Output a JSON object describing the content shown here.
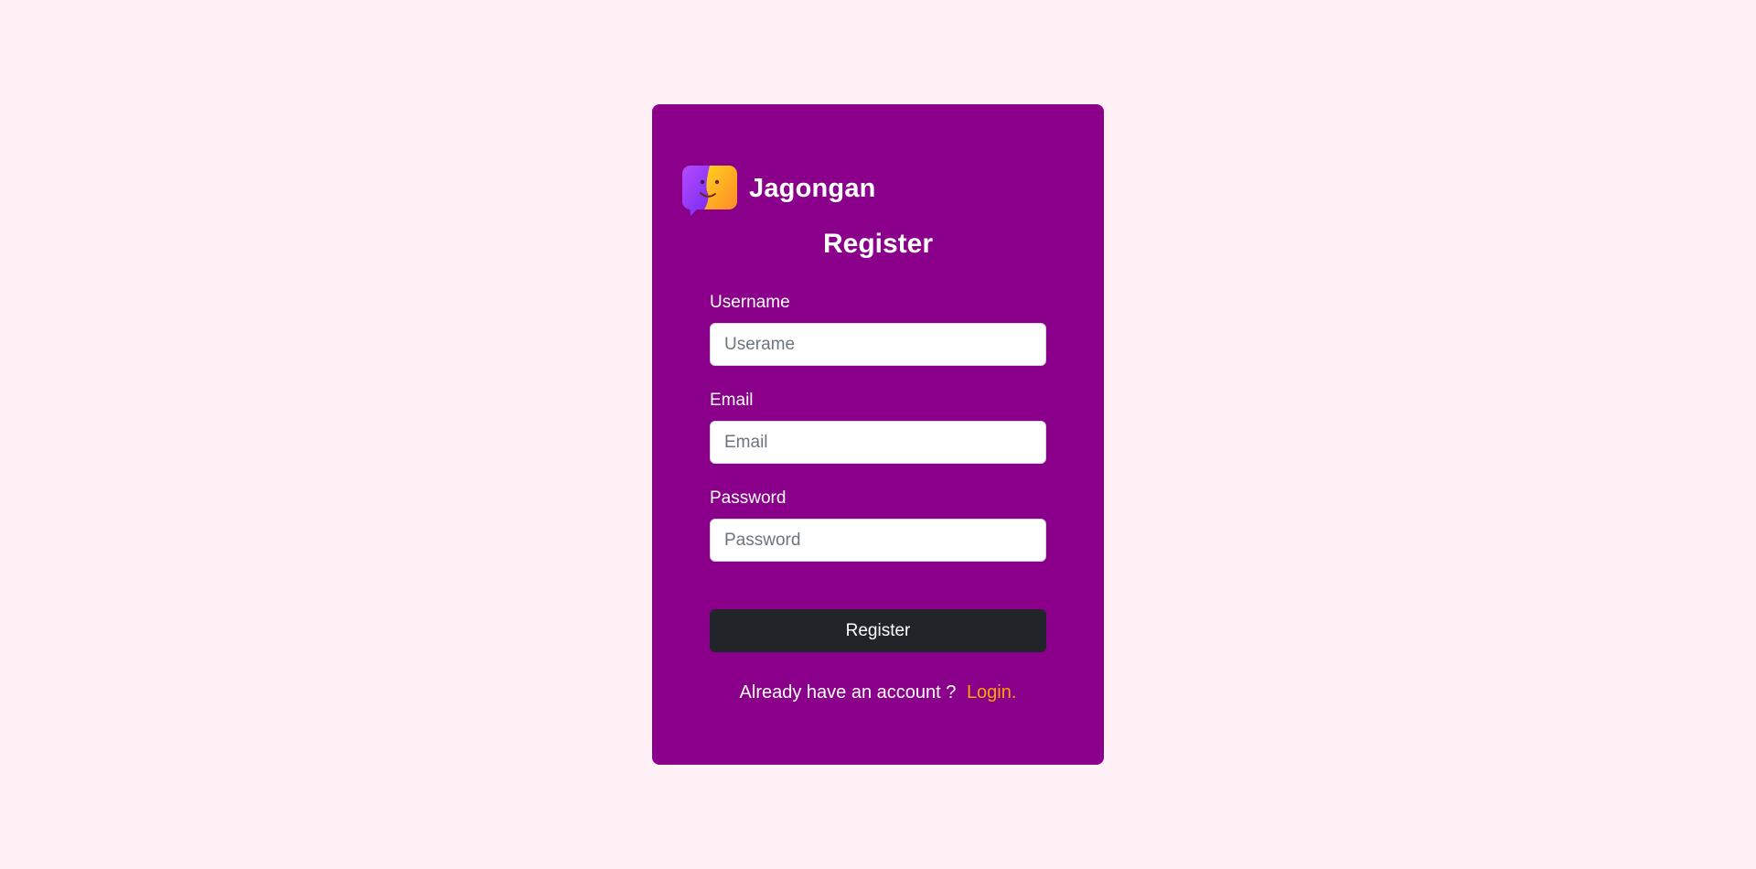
{
  "brand": {
    "name": "Jagongan",
    "logo_icon": "chat-face-icon"
  },
  "form": {
    "title": "Register",
    "fields": [
      {
        "label": "Username",
        "placeholder": "Userame",
        "value": ""
      },
      {
        "label": "Email",
        "placeholder": "Email",
        "value": ""
      },
      {
        "label": "Password",
        "placeholder": "Password",
        "value": ""
      }
    ],
    "submit_label": "Register"
  },
  "footer": {
    "prompt": "Already have an account ?",
    "link_label": "Login."
  },
  "colors": {
    "page_background": "#fff0f5",
    "card_background": "#8b008b",
    "button_background": "#212529",
    "link": "#ffa500"
  }
}
